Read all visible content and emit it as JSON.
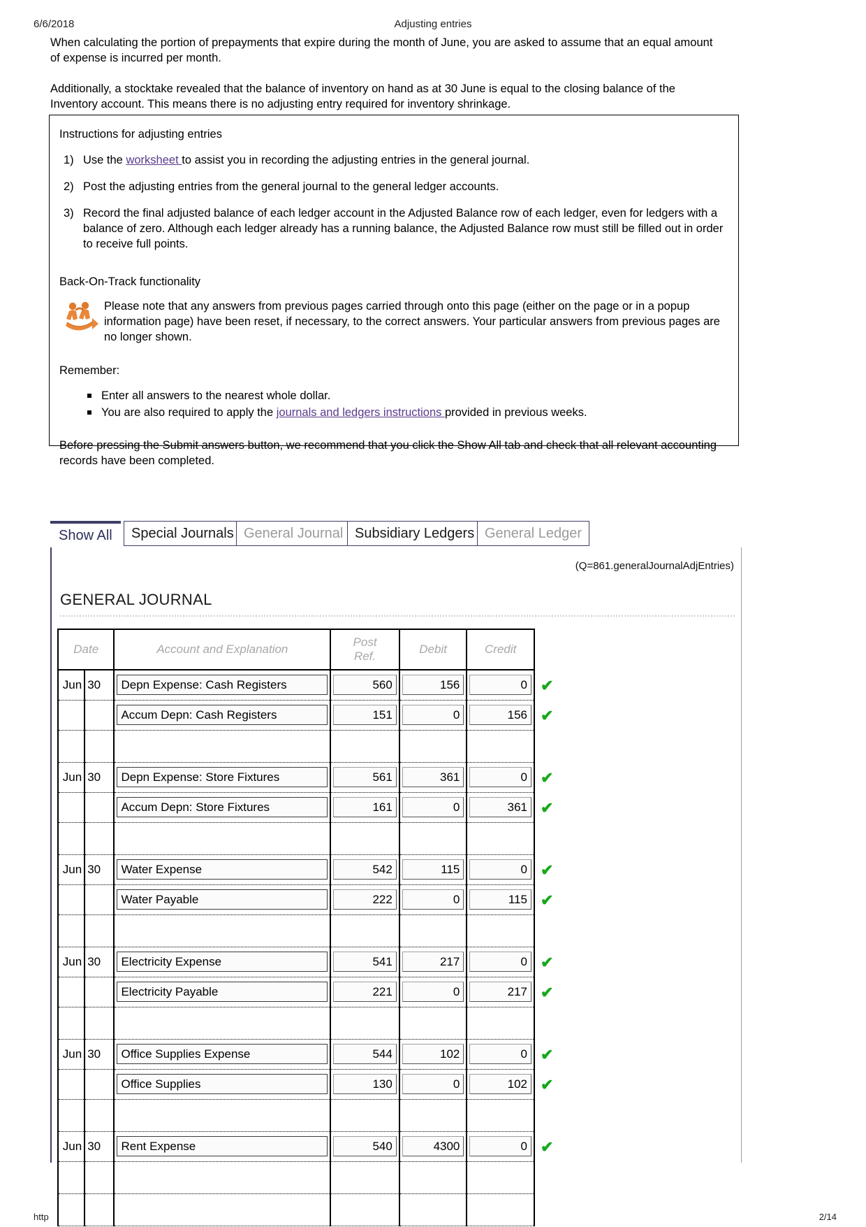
{
  "header": {
    "date": "6/6/2018",
    "title": "Adjusting entries"
  },
  "intro": {
    "p1": "When calculating the portion of prepayments that expire during the month of June, you are asked to assume that an equal amount of expense is incurred per month.",
    "p2": "Additionally, a stocktake revealed that the balance of inventory on hand as at 30 June is equal to the closing balance of the Inventory account. This means there is no adjusting entry required for inventory shrinkage."
  },
  "instructions": {
    "title": "Instructions for adjusting entries",
    "items": [
      {
        "num": "1)",
        "pre": "Use the ",
        "link": "worksheet ",
        "post": "to assist you in recording the adjusting entries in the general journal."
      },
      {
        "num": "2)",
        "pre": "Post the adjusting entries from the general journal to the general ledger accounts.",
        "link": "",
        "post": ""
      },
      {
        "num": "3)",
        "pre": "Record the final adjusted balance of each ledger account in the Adjusted Balance row of each ledger, even for ledgers with a balance of zero. Although each ledger already has a running balance, the Adjusted Balance row must still be filled out in order to receive full points.",
        "link": "",
        "post": ""
      }
    ],
    "back_on_track_title": "Back-On-Track functionality",
    "back_on_track_text": "Please note that any answers from previous pages carried through onto this page (either on the page or in a popup information page) have been reset, if necessary, to the correct answers. Your particular answers from previous pages are no longer shown.",
    "back_on_track_icon": "back-on-track-people-icon",
    "remember_title": "Remember:",
    "remember_items": [
      {
        "pre": "Enter all answers to the nearest whole dollar.",
        "link": "",
        "post": ""
      },
      {
        "pre": "You are also required to apply the ",
        "link": "journals and ledgers instructions ",
        "post": "provided in previous weeks."
      }
    ],
    "closing": "Before pressing the Submit answers button, we recommend that you click the Show All tab and check that all relevant accounting records have been completed."
  },
  "tabs": [
    {
      "label": "Show All",
      "state": "active"
    },
    {
      "label": "Special Journals",
      "state": "enabled"
    },
    {
      "label": "General Journal",
      "state": "disabled"
    },
    {
      "label": "Subsidiary Ledgers",
      "state": "enabled"
    },
    {
      "label": "General Ledger",
      "state": "disabled"
    }
  ],
  "panel": {
    "question_code": "(Q=861.generalJournalAdjEntries)",
    "section_title": "GENERAL JOURNAL"
  },
  "journal": {
    "columns": [
      "Date",
      "Account and Explanation",
      "Post Ref.",
      "Debit",
      "Credit"
    ],
    "col_date": "Date",
    "col_account": "Account and Explanation",
    "col_post_a": "Post",
    "col_post_b": "Ref.",
    "col_debit": "Debit",
    "col_credit": "Credit",
    "rows": [
      {
        "kind": "entry",
        "month": "Jun",
        "day": "30",
        "account": "Depn Expense: Cash Registers",
        "post_ref": "560",
        "debit": "156",
        "credit": "0",
        "check": "✔"
      },
      {
        "kind": "entry",
        "month": "",
        "day": "",
        "account": "Accum Depn: Cash Registers",
        "post_ref": "151",
        "debit": "0",
        "credit": "156",
        "check": "✔"
      },
      {
        "kind": "spacer",
        "month": "",
        "day": "",
        "account": "",
        "post_ref": "",
        "debit": "",
        "credit": "",
        "check": ""
      },
      {
        "kind": "entry",
        "month": "Jun",
        "day": "30",
        "account": "Depn Expense: Store Fixtures",
        "post_ref": "561",
        "debit": "361",
        "credit": "0",
        "check": "✔"
      },
      {
        "kind": "entry",
        "month": "",
        "day": "",
        "account": "Accum Depn: Store Fixtures",
        "post_ref": "161",
        "debit": "0",
        "credit": "361",
        "check": "✔"
      },
      {
        "kind": "spacer",
        "month": "",
        "day": "",
        "account": "",
        "post_ref": "",
        "debit": "",
        "credit": "",
        "check": ""
      },
      {
        "kind": "entry",
        "month": "Jun",
        "day": "30",
        "account": "Water Expense",
        "post_ref": "542",
        "debit": "115",
        "credit": "0",
        "check": "✔"
      },
      {
        "kind": "entry",
        "month": "",
        "day": "",
        "account": "Water Payable",
        "post_ref": "222",
        "debit": "0",
        "credit": "115",
        "check": "✔"
      },
      {
        "kind": "spacer",
        "month": "",
        "day": "",
        "account": "",
        "post_ref": "",
        "debit": "",
        "credit": "",
        "check": ""
      },
      {
        "kind": "entry",
        "month": "Jun",
        "day": "30",
        "account": "Electricity Expense",
        "post_ref": "541",
        "debit": "217",
        "credit": "0",
        "check": "✔"
      },
      {
        "kind": "entry",
        "month": "",
        "day": "",
        "account": "Electricity Payable",
        "post_ref": "221",
        "debit": "0",
        "credit": "217",
        "check": "✔"
      },
      {
        "kind": "spacer",
        "month": "",
        "day": "",
        "account": "",
        "post_ref": "",
        "debit": "",
        "credit": "",
        "check": ""
      },
      {
        "kind": "entry",
        "month": "Jun",
        "day": "30",
        "account": "Office Supplies Expense",
        "post_ref": "544",
        "debit": "102",
        "credit": "0",
        "check": "✔"
      },
      {
        "kind": "entry",
        "month": "",
        "day": "",
        "account": "Office Supplies",
        "post_ref": "130",
        "debit": "0",
        "credit": "102",
        "check": "✔"
      },
      {
        "kind": "spacer",
        "month": "",
        "day": "",
        "account": "",
        "post_ref": "",
        "debit": "",
        "credit": "",
        "check": ""
      },
      {
        "kind": "entry",
        "month": "Jun",
        "day": "30",
        "account": "Rent Expense",
        "post_ref": "540",
        "debit": "4300",
        "credit": "0",
        "check": "✔"
      },
      {
        "kind": "spacer",
        "month": "",
        "day": "",
        "account": "",
        "post_ref": "",
        "debit": "",
        "credit": "",
        "check": ""
      },
      {
        "kind": "spacer",
        "month": "",
        "day": "",
        "account": "",
        "post_ref": "",
        "debit": "",
        "credit": "",
        "check": ""
      }
    ]
  },
  "footer": {
    "url": "http",
    "page": "2/14"
  },
  "colors": {
    "tab_accent": "#3e3e66",
    "link": "#5b3a8e",
    "check_green": "#17a81a",
    "disabled_text": "#9b9b9b"
  }
}
